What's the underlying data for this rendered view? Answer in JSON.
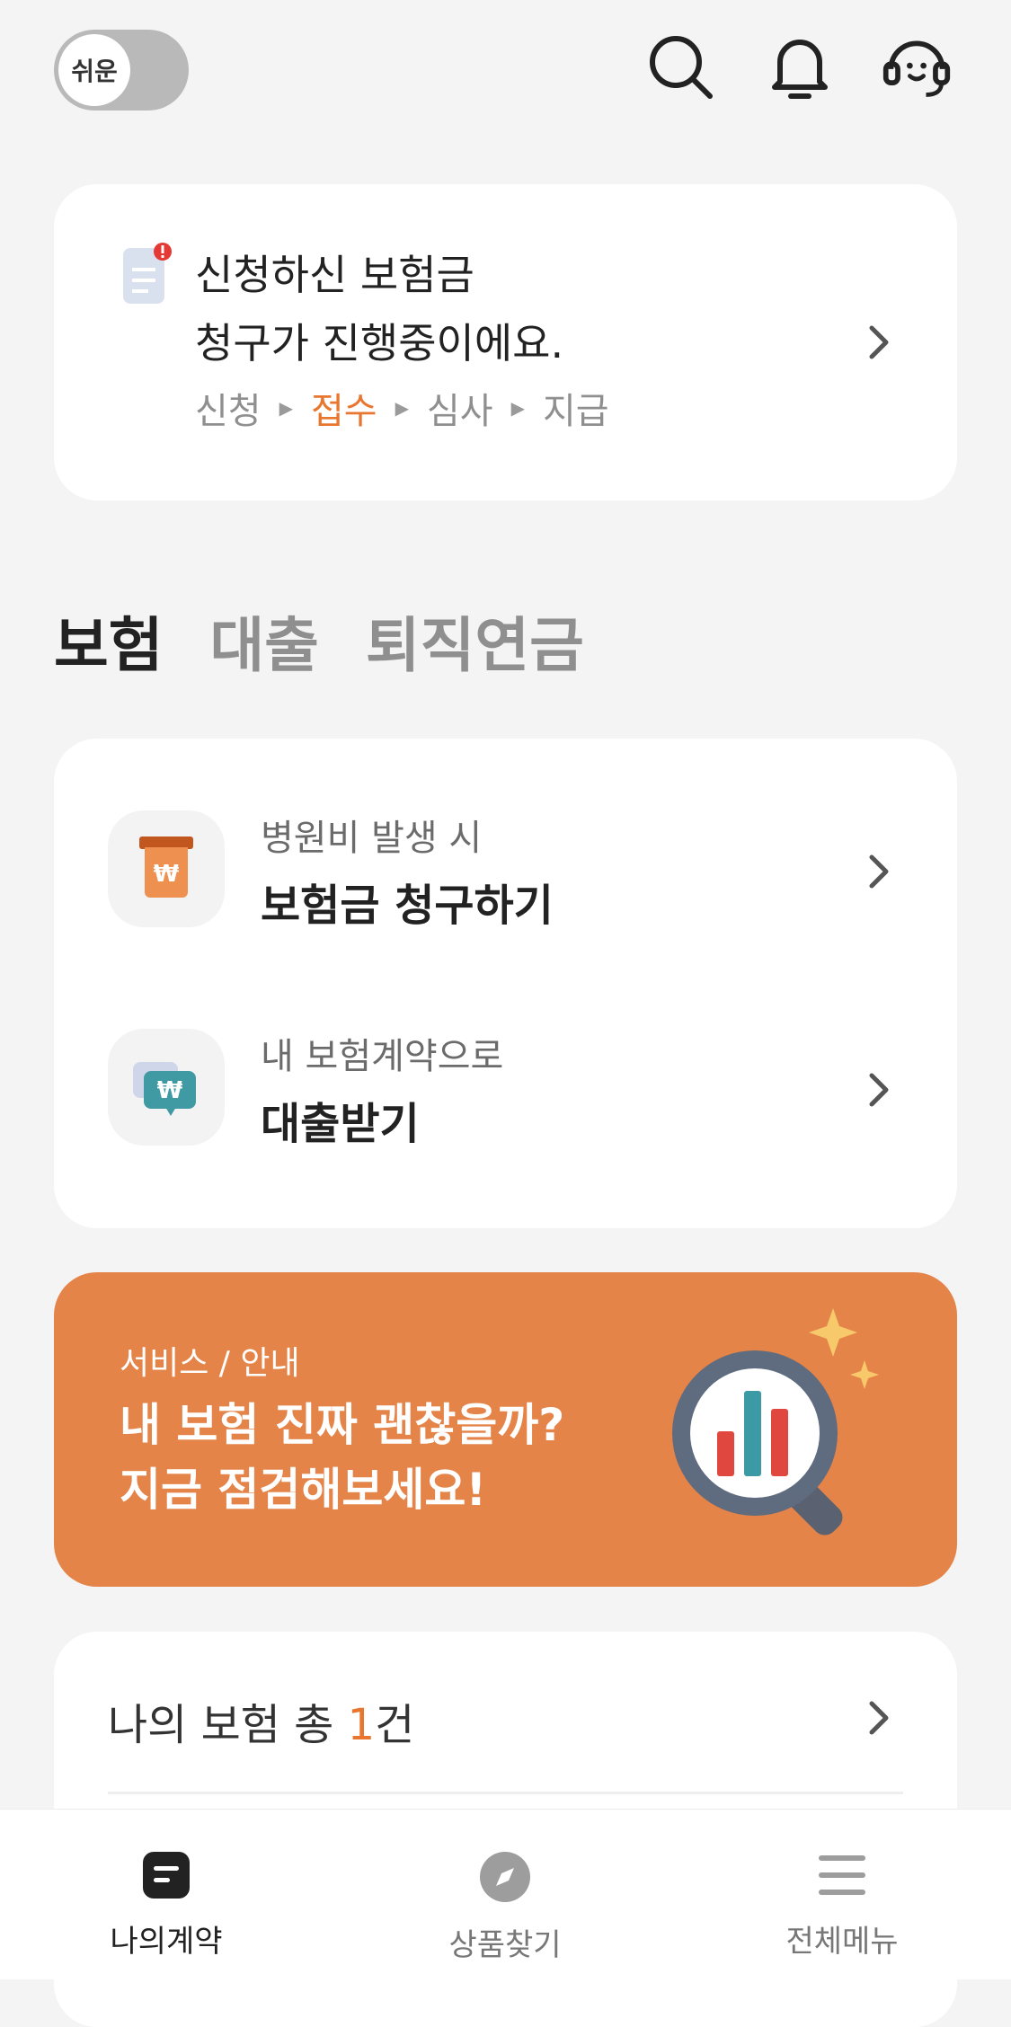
{
  "top_bar": {
    "easy_mode_label": "쉬운"
  },
  "claim_status": {
    "line1": "신청하신 보험금",
    "line2": "청구가 진행중이에요.",
    "steps": [
      "신청",
      "접수",
      "심사",
      "지급"
    ],
    "active_step": "접수"
  },
  "tabs": [
    "보험",
    "대출",
    "퇴직연금"
  ],
  "insurance_menu": [
    {
      "sub": "병원비 발생 시",
      "main": "보험금 청구하기",
      "icon": "receipt-won-icon"
    },
    {
      "sub": "내 보험계약으로",
      "main": "대출받기",
      "icon": "chat-won-icon"
    }
  ],
  "banner": {
    "category": "서비스 / 안내",
    "line1": "내 보험 진짜 괜찮을까?",
    "line2": "지금 점검해보세요!"
  },
  "my_insurance": {
    "prefix": "나의 보험 총 ",
    "count": "1",
    "suffix": "건"
  },
  "bottom_nav": [
    {
      "label": "나의계약",
      "icon": "document-icon"
    },
    {
      "label": "상품찾기",
      "icon": "compass-icon"
    },
    {
      "label": "전체메뉴",
      "icon": "menu-icon"
    }
  ],
  "colors": {
    "accent": "#e8762f",
    "banner": "#e58448",
    "background": "#f4f4f4"
  }
}
